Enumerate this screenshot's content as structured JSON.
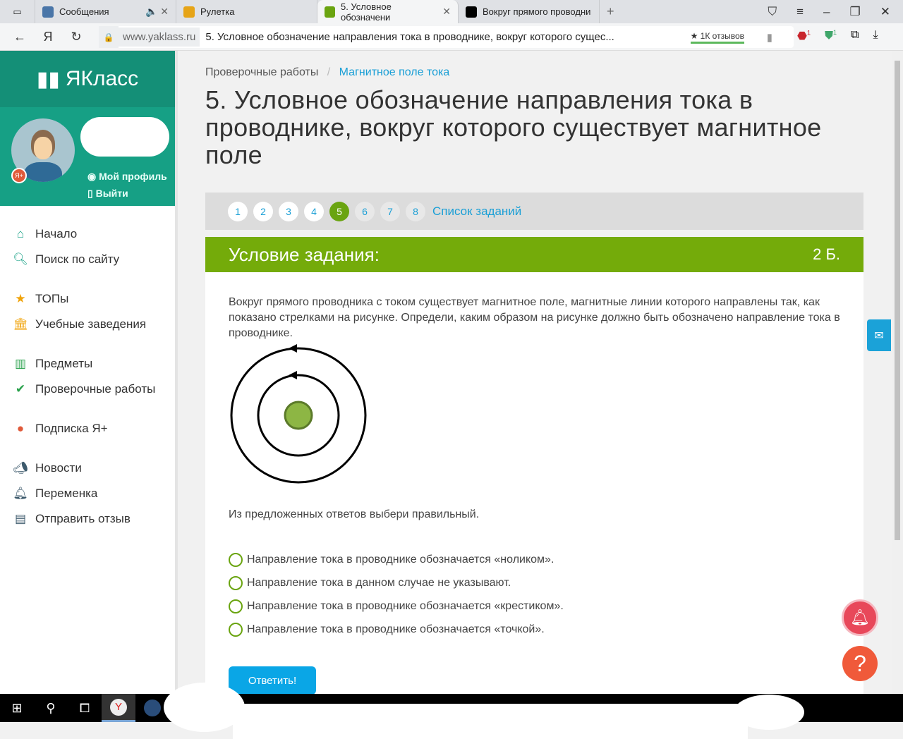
{
  "browser": {
    "tabs": [
      {
        "label": "Сообщения",
        "icon": "vk-icon",
        "color": "#4a76a8"
      },
      {
        "label": "Рулетка",
        "icon": "roulette-icon",
        "color": "#e6a417"
      },
      {
        "label": "5. Условное обозначени",
        "icon": "yaklass-icon",
        "color": "#6aa410"
      },
      {
        "label": "Вокруг прямого проводни",
        "icon": "znanija-icon",
        "color": "#000000"
      }
    ],
    "host": "www.yaklass.ru",
    "page_title": "5. Условное обозначение направления тока в проводнике, вокруг которого сущес...",
    "reviews": "★ 1К отзывов",
    "ext_badge_1": "1",
    "ext_badge_2": "1"
  },
  "sidebar": {
    "logo": "ЯКласс",
    "profile_link": "Мой профиль",
    "logout_link": "Выйти",
    "badge": "Я+",
    "items": [
      {
        "label": "Начало",
        "icon": "home-icon"
      },
      {
        "label": "Поиск по сайту",
        "icon": "search-icon"
      },
      {
        "label": "ТОПы",
        "icon": "star-icon"
      },
      {
        "label": "Учебные заведения",
        "icon": "school-icon"
      },
      {
        "label": "Предметы",
        "icon": "book-icon"
      },
      {
        "label": "Проверочные работы",
        "icon": "check-circle-icon"
      },
      {
        "label": "Подписка Я+",
        "icon": "subscription-icon"
      },
      {
        "label": "Новости",
        "icon": "megaphone-icon"
      },
      {
        "label": "Переменка",
        "icon": "bell-icon"
      },
      {
        "label": "Отправить отзыв",
        "icon": "feedback-icon"
      }
    ]
  },
  "main": {
    "breadcrumb": [
      "Проверочные работы",
      "Магнитное поле тока"
    ],
    "title": "5. Условное обозначение направления тока в проводнике, вокруг которого существует магнитное поле",
    "pages": [
      "1",
      "2",
      "3",
      "4",
      "5",
      "6",
      "7",
      "8"
    ],
    "current_page": "5",
    "task_list": "Список заданий",
    "header": "Условие задания:",
    "points": "2 Б.",
    "question": "Вокруг прямого проводника с током существует магнитное поле, магнитные линии которого направлены так, как показано стрелками на рисунке. Определи, каким образом на рисунке должно быть обозначено направление тока в проводнике.",
    "prompt": "Из предложенных ответов выбери правильный.",
    "options": [
      "Направление тока в проводнике обозначается «ноликом».",
      "Направление тока в данном случае не указывают.",
      "Направление тока в проводнике обозначается «крестиком».",
      "Направление тока в проводнике обозначается «точкой»."
    ],
    "submit": "Ответить!"
  },
  "colors": {
    "accent": "#74ab0a",
    "teal": "#16a085",
    "link": "#1a9fd6"
  }
}
